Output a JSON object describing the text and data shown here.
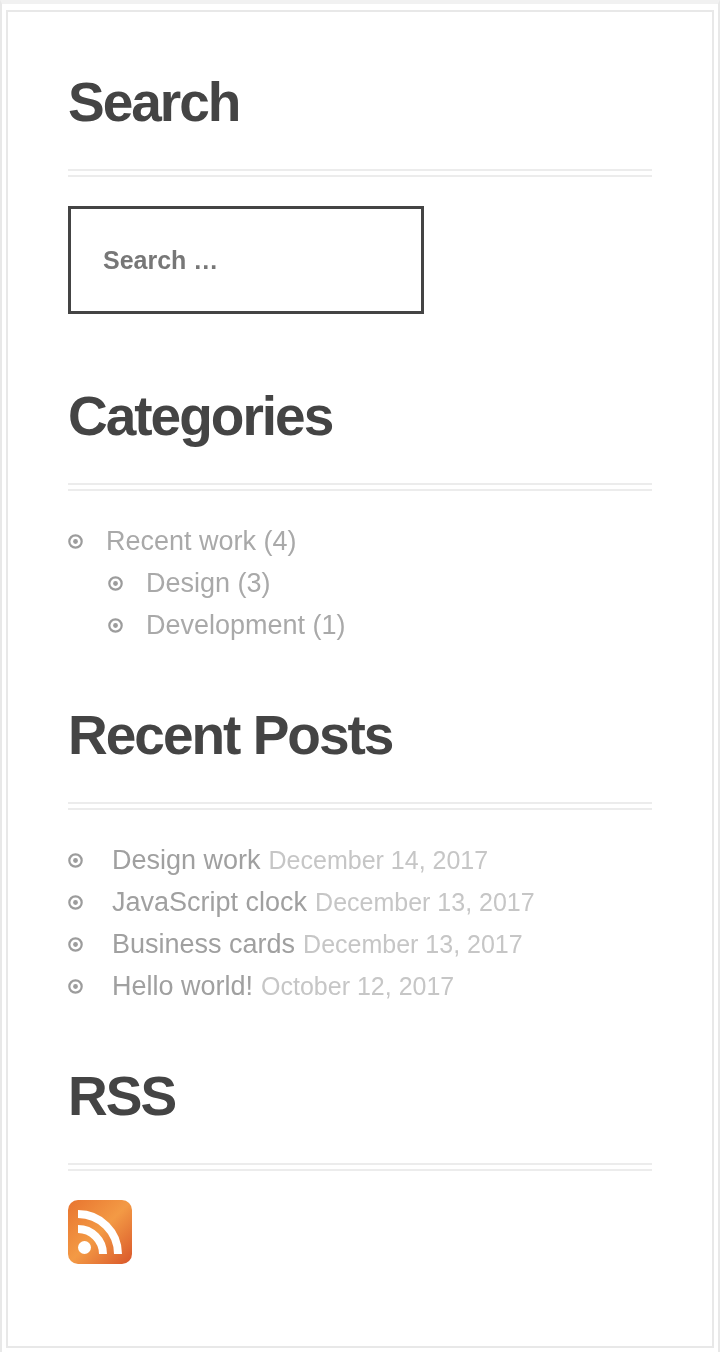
{
  "widgets": [
    {
      "kind": "search",
      "title": "Search",
      "placeholder": "Search …"
    },
    {
      "kind": "categories",
      "title": "Categories",
      "items": [
        {
          "label": "Recent work (4)",
          "children": [
            {
              "label": "Design (3)"
            },
            {
              "label": "Development (1)"
            }
          ]
        }
      ]
    },
    {
      "kind": "posts",
      "title": "Recent Posts",
      "items": [
        {
          "title": "Design work",
          "date": "December 14, 2017"
        },
        {
          "title": "JavaScript clock",
          "date": "December 13, 2017"
        },
        {
          "title": "Business cards",
          "date": "December 13, 2017"
        },
        {
          "title": "Hello world!",
          "date": "October 12, 2017"
        }
      ]
    },
    {
      "kind": "rss",
      "title": "RSS"
    }
  ]
}
